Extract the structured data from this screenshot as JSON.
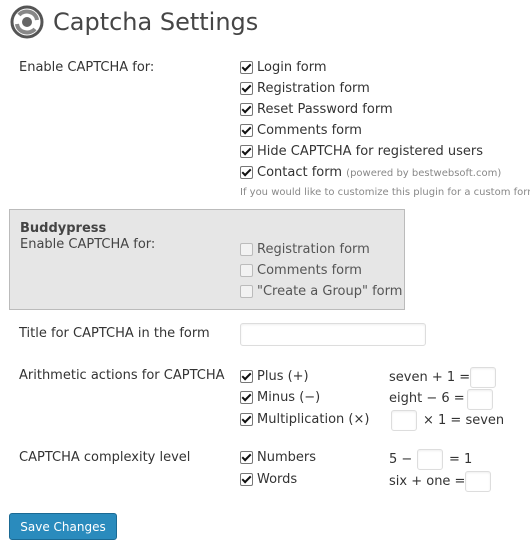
{
  "title": "Captcha Settings",
  "enable": {
    "label": "Enable CAPTCHA for:",
    "options": [
      {
        "label": "Login form",
        "checked": true
      },
      {
        "label": "Registration form",
        "checked": true
      },
      {
        "label": "Reset Password form",
        "checked": true
      },
      {
        "label": "Comments form",
        "checked": true
      },
      {
        "label": "Hide CAPTCHA for registered users",
        "checked": true
      },
      {
        "label": "Contact form",
        "checked": true
      }
    ],
    "contact_note": "(powered by bestwebsoft.com)",
    "hint": "If you would like to customize this plugin for a custom form"
  },
  "buddypress": {
    "heading": "Buddypress",
    "label": "Enable CAPTCHA for:",
    "options": [
      {
        "label": "Registration form",
        "checked": false
      },
      {
        "label": "Comments form",
        "checked": false
      },
      {
        "label": "\"Create a Group\" form",
        "checked": false
      }
    ]
  },
  "title_field": {
    "label": "Title for CAPTCHA in the form",
    "value": ""
  },
  "arithmetic": {
    "label": "Arithmetic actions for CAPTCHA",
    "options": [
      {
        "label": "Plus (+)",
        "checked": true,
        "example_left": "seven + 1 =",
        "example_right": ""
      },
      {
        "label": "Minus (−)",
        "checked": true,
        "example_left": "eight − 6 =",
        "example_right": ""
      },
      {
        "label": "Multiplication (×)",
        "checked": true,
        "example_left": "",
        "example_right": "× 1 = seven"
      }
    ]
  },
  "complexity": {
    "label": "CAPTCHA complexity level",
    "options": [
      {
        "label": "Numbers",
        "checked": true,
        "example_left": "5 −",
        "example_right": "= 1"
      },
      {
        "label": "Words",
        "checked": true,
        "example_left": "six + one =",
        "example_right": ""
      }
    ]
  },
  "save_button": "Save Changes",
  "colors": {
    "button": "#2a8bbd",
    "buddypress_box": "#e6e6e6"
  },
  "icons": {
    "title": "plugin-logo-icon",
    "checkbox": "checkmark-icon"
  }
}
